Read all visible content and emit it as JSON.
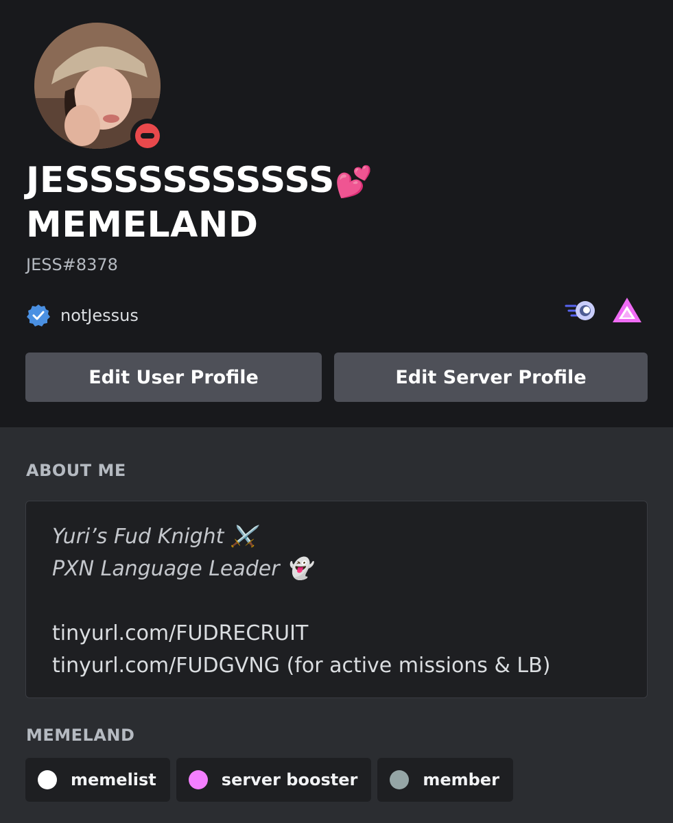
{
  "profile": {
    "display_name_line1": "JESSSSSSSSSSS",
    "display_name_emoji": "💕",
    "display_name_line2": "MEMELAND",
    "username_tag": "JESS#8378",
    "status": "do-not-disturb",
    "status_color": "#e8494c"
  },
  "connection": {
    "icon": "verified-badge-icon",
    "name": "notJessus"
  },
  "badges": [
    {
      "icon": "nitro-badge-icon"
    },
    {
      "icon": "hypesquad-triangle-badge-icon"
    }
  ],
  "buttons": {
    "edit_user_profile": "Edit User Profile",
    "edit_server_profile": "Edit Server Profile"
  },
  "about_me": {
    "title": "ABOUT ME",
    "line1": "Yuri’s Fud Knight ⚔️",
    "line2": "PXN Language Leader 👻",
    "line3": "tinyurl.com/FUDRECRUIT",
    "line4": "tinyurl.com/FUDGVNG (for active missions & LB)"
  },
  "roles_section": {
    "title": "MEMELAND",
    "roles": [
      {
        "name": "memelist",
        "color": "#ffffff"
      },
      {
        "name": "server booster",
        "color": "#f47fff"
      },
      {
        "name": "member",
        "color": "#95a5a6"
      }
    ]
  },
  "colors": {
    "header_bg": "#18191c",
    "body_bg": "#2b2d31",
    "button_bg": "#4e5058"
  }
}
